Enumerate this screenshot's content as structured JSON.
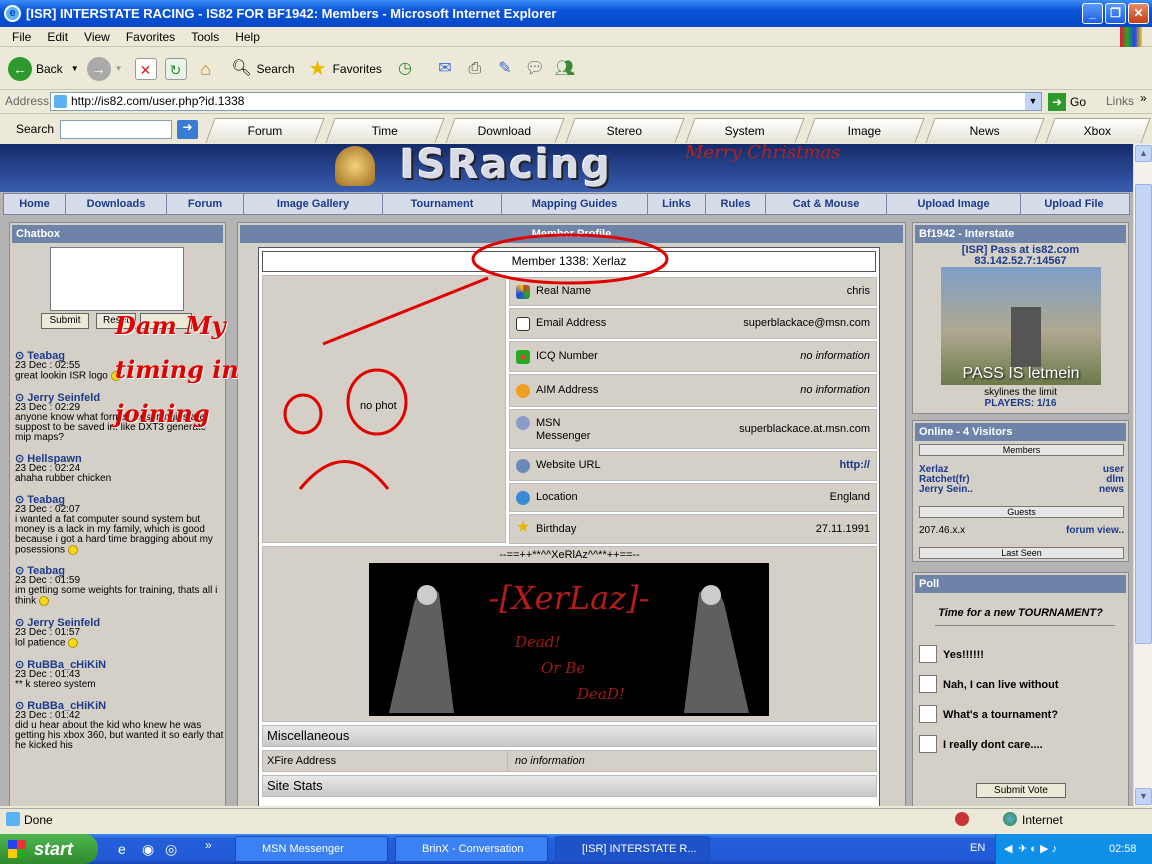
{
  "window": {
    "title": "[ISR] INTERSTATE RACING - IS82 FOR BF1942: Members - Microsoft Internet Explorer"
  },
  "menu": [
    "File",
    "Edit",
    "View",
    "Favorites",
    "Tools",
    "Help"
  ],
  "toolbar": {
    "back": "Back",
    "search": "Search",
    "favorites": "Favorites"
  },
  "address": {
    "label": "Address",
    "url": "http://is82.com/user.php?id.1338",
    "go": "Go",
    "links": "Links"
  },
  "linksbar": {
    "search_label": "Search",
    "tabs": [
      "Forum",
      "Time",
      "Download",
      "Stereo",
      "System",
      "Image",
      "News",
      "Xbox"
    ]
  },
  "site": {
    "logo": "ISRacing",
    "greeting": "Merry Christmas",
    "nav": [
      "Home",
      "Downloads",
      "Forum",
      "Image Gallery",
      "Tournament",
      "Mapping Guides",
      "Links",
      "Rules",
      "Cat & Mouse",
      "Upload Image",
      "Upload File"
    ]
  },
  "chatbox": {
    "title": "Chatbox",
    "submit": "Submit",
    "reset": "Reset",
    "messages": [
      {
        "author": "Teabag",
        "time": "23 Dec : 02:55",
        "text": "great lookin ISR logo"
      },
      {
        "author": "Jerry Seinfeld",
        "time": "23 Dec : 02:29",
        "text": "anyone know what format .dds thingies are suppost to be saved in. like DXT3 generate mip maps?"
      },
      {
        "author": "Hellspawn",
        "time": "23 Dec : 02:24",
        "text": "ahaha rubber chicken"
      },
      {
        "author": "Teabag",
        "time": "23 Dec : 02:07",
        "text": "i wanted a fat computer sound system but money is a lack in my family, which is good because i got a hard time bragging about my posessions"
      },
      {
        "author": "Teabag",
        "time": "23 Dec : 01:59",
        "text": "im getting some weights for training, thats all i think"
      },
      {
        "author": "Jerry Seinfeld",
        "time": "23 Dec : 01:57",
        "text": "lol patience"
      },
      {
        "author": "RuBBa_cHiKiN",
        "time": "23 Dec : 01:43",
        "text": "** k stereo system"
      },
      {
        "author": "RuBBa_cHiKiN",
        "time": "23 Dec : 01:42",
        "text": "did u hear about the kid who knew he was getting his xbox 360, but wanted it so early that he kicked his"
      }
    ]
  },
  "annotation": {
    "line1": "Dam My",
    "line2": "timing in",
    "line3": "joining"
  },
  "profile": {
    "panel_title": "Member Profile",
    "member_title": "Member 1338: Xerlaz",
    "photo_text": "no phot",
    "fields": [
      {
        "label": "Real Name",
        "value": "chris"
      },
      {
        "label": "Email Address",
        "value": "superblackace@msn.com"
      },
      {
        "label": "ICQ Number",
        "value": "no information"
      },
      {
        "label": "AIM Address",
        "value": "no information"
      },
      {
        "label": "MSN Messenger",
        "value": "superblackace.at.msn.com"
      },
      {
        "label": "Website URL",
        "value": "http://"
      },
      {
        "label": "Location",
        "value": "England"
      },
      {
        "label": "Birthday",
        "value": "27.11.1991"
      }
    ],
    "signature_caption": "--==++**^^XeRlAz^^**++==--",
    "sig_title": "-[XerLaz]-",
    "sig_line1": "Dead!",
    "sig_line2": "Or Be",
    "sig_line3": "DeaD!",
    "misc_title": "Miscellaneous",
    "xfire_label": "XFire Address",
    "xfire_value": "no information",
    "stats_title": "Site Stats"
  },
  "server": {
    "title": "Bf1942 - Interstate",
    "name": "[ISR] Pass at is82.com",
    "ip": "83.142.52.7:14567",
    "map_caption": "PASS IS letmein",
    "tagline": "skylines the limit",
    "players": "PLAYERS: 1/16"
  },
  "online": {
    "title": "Online - 4 Visitors",
    "members_hdr": "Members",
    "members": [
      {
        "name": "Xerlaz",
        "where": "user"
      },
      {
        "name": "Ratchet(fr)",
        "where": "dlm"
      },
      {
        "name": "Jerry Sein..",
        "where": "news"
      }
    ],
    "guests_hdr": "Guests",
    "guest_ip": "207.46.x.x",
    "guest_where": "forum  view..",
    "lastseen_hdr": "Last Seen"
  },
  "poll": {
    "title": "Poll",
    "question": "Time for a new TOURNAMENT?",
    "options": [
      "Yes!!!!!!",
      "Nah, I can live without",
      "What's a tournament?",
      "I really dont care...."
    ],
    "submit": "Submit Vote"
  },
  "statusbar": {
    "text": "Done",
    "zone": "Internet"
  },
  "taskbar": {
    "start": "start",
    "tasks": [
      "MSN Messenger",
      "BrinX - Conversation",
      "[ISR] INTERSTATE R..."
    ],
    "lang": "EN",
    "clock": "02:58"
  },
  "colors": {
    "accent": "#0A53D8",
    "annotation": "#E00000",
    "link": "#1b3a8c"
  }
}
